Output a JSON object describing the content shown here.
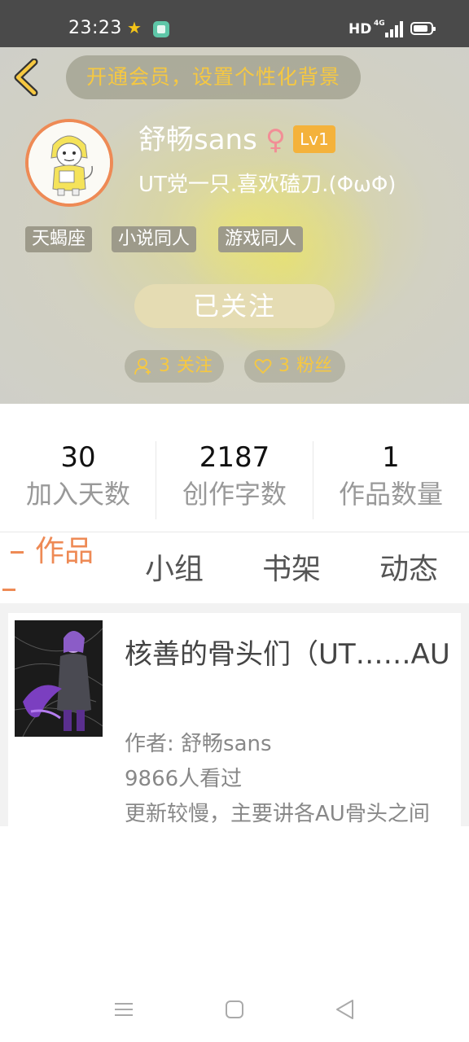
{
  "status_bar": {
    "time": "23:23",
    "network": "HD",
    "signal_label": "4G",
    "icons": [
      "star-icon",
      "app-icon",
      "signal-icon",
      "battery-icon"
    ]
  },
  "header": {
    "vip_banner": "开通会员，设置个性化背景",
    "username": "舒畅sans",
    "gender_symbol": "♀",
    "level": "Lv1",
    "bio": "UT党一只.喜欢磕刀.(ΦωΦ)",
    "tags": [
      "天蝎座",
      "小说同人",
      "游戏同人"
    ],
    "follow_button": "已关注",
    "following": {
      "count": "3",
      "label": "关注"
    },
    "fans": {
      "count": "3",
      "label": "粉丝"
    }
  },
  "stats": [
    {
      "value": "30",
      "label": "加入天数"
    },
    {
      "value": "2187",
      "label": "创作字数"
    },
    {
      "value": "1",
      "label": "作品数量"
    }
  ],
  "tabs": [
    {
      "label": "作品",
      "active": true
    },
    {
      "label": "小组",
      "active": false
    },
    {
      "label": "书架",
      "active": false
    },
    {
      "label": "动态",
      "active": false
    }
  ],
  "works": [
    {
      "title": "核善的骨头们（UT……AU",
      "author": "作者: 舒畅sans",
      "views": "9866人看过",
      "summary": "更新较慢，主要讲各AU骨头之间"
    }
  ],
  "colors": {
    "accent": "#ee8a55",
    "gold": "#f6c841",
    "level_badge": "#f4b23b",
    "gender": "#f28e96"
  }
}
